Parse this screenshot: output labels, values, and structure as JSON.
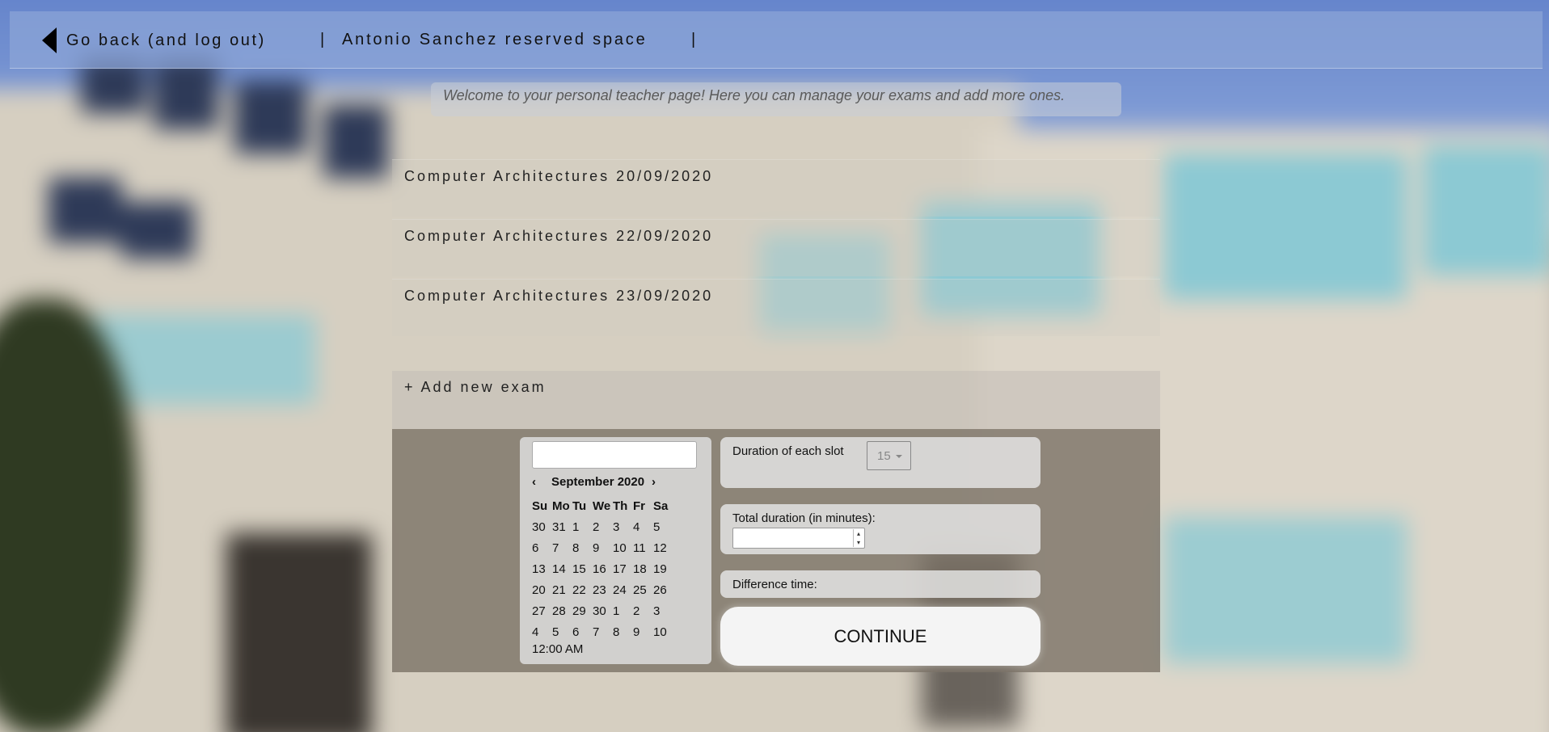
{
  "header": {
    "back_label": "Go back (and log out)",
    "separator": "|",
    "owner_label": "Antonio Sanchez reserved space"
  },
  "welcome_text": "Welcome to your personal teacher page! Here you can manage your exams and add more ones.",
  "exams": [
    {
      "label": "Computer Architectures 20/09/2020"
    },
    {
      "label": "Computer Architectures 22/09/2020"
    },
    {
      "label": "Computer Architectures 23/09/2020"
    }
  ],
  "add_exam_label": "+ Add new exam",
  "datepicker": {
    "input_value": "",
    "prev": "‹",
    "next": "›",
    "month_title": "September 2020",
    "weekdays": [
      "Su",
      "Mo",
      "Tu",
      "We",
      "Th",
      "Fr",
      "Sa"
    ],
    "weeks": [
      [
        "30",
        "31",
        "1",
        "2",
        "3",
        "4",
        "5"
      ],
      [
        "6",
        "7",
        "8",
        "9",
        "10",
        "11",
        "12"
      ],
      [
        "13",
        "14",
        "15",
        "16",
        "17",
        "18",
        "19"
      ],
      [
        "20",
        "21",
        "22",
        "23",
        "24",
        "25",
        "26"
      ],
      [
        "27",
        "28",
        "29",
        "30",
        "1",
        "2",
        "3"
      ],
      [
        "4",
        "5",
        "6",
        "7",
        "8",
        "9",
        "10"
      ]
    ],
    "time": "12:00 AM"
  },
  "slot_duration": {
    "label": "Duration of each slot",
    "value": "15"
  },
  "total_duration": {
    "label": "Total duration (in minutes):",
    "value": ""
  },
  "difference": {
    "label": "Difference time:"
  },
  "continue_label": "CONTINUE"
}
